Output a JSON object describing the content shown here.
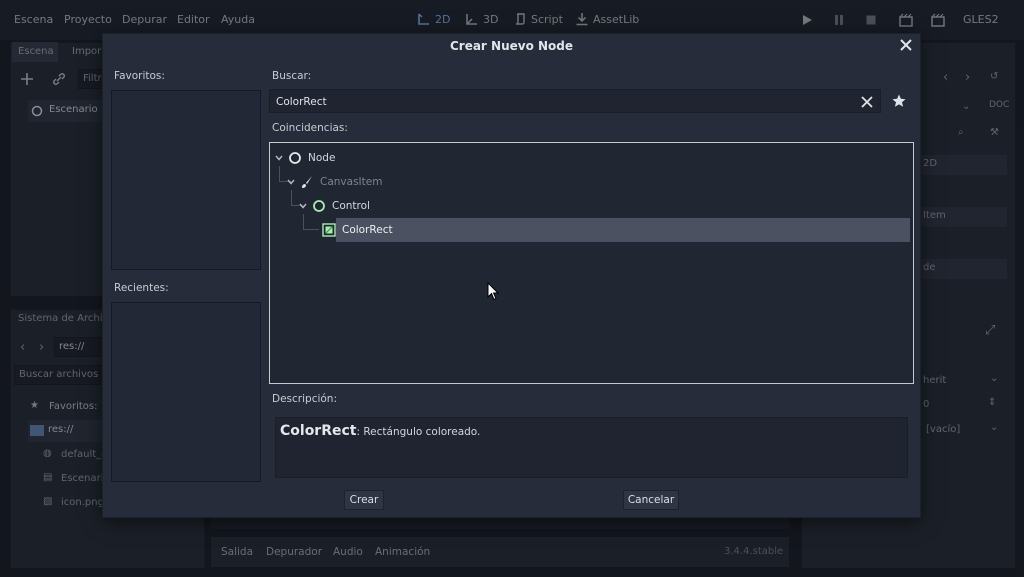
{
  "menu": [
    "Escena",
    "Proyecto",
    "Depurar",
    "Editor",
    "Ayuda"
  ],
  "workspaces": [
    "2D",
    "3D",
    "Script",
    "AssetLib"
  ],
  "renderer": "GLES2",
  "scene_dock": {
    "tab_active": "Escena",
    "tab_other": "Impor",
    "filter_placeholder": "Filtr",
    "root_node": "Escenario"
  },
  "filesystem_dock": {
    "title": "Sistema de Archiv",
    "path": "res://",
    "search_placeholder": "Buscar archivos",
    "favorites": "Favoritos:",
    "items": [
      "res://",
      "default_e",
      "Escenari",
      "icon.png"
    ]
  },
  "inspector_bg": {
    "partial": [
      "2D",
      "Item",
      "de",
      "herit",
      "0",
      "[vacío]"
    ]
  },
  "bottom_tabs": [
    "Salida",
    "Depurador",
    "Audio",
    "Animación"
  ],
  "version": "3.4.4.stable",
  "dialog": {
    "title": "Crear Nuevo Node",
    "favorites_label": "Favoritos:",
    "recent_label": "Recientes:",
    "search_label": "Buscar:",
    "search_value": "ColorRect",
    "matches_label": "Coincidencias:",
    "tree": [
      {
        "label": "Node",
        "icon": "node-circle-icon",
        "muted": false
      },
      {
        "label": "CanvasItem",
        "icon": "brush-icon",
        "muted": true
      },
      {
        "label": "Control",
        "icon": "control-circle-icon",
        "muted": false
      },
      {
        "label": "ColorRect",
        "icon": "color-rect-icon",
        "muted": false
      }
    ],
    "description_label": "Descripción:",
    "description_name": "ColorRect",
    "description_text": ": Rectángulo coloreado.",
    "create_button": "Crear",
    "cancel_button": "Cancelar"
  }
}
